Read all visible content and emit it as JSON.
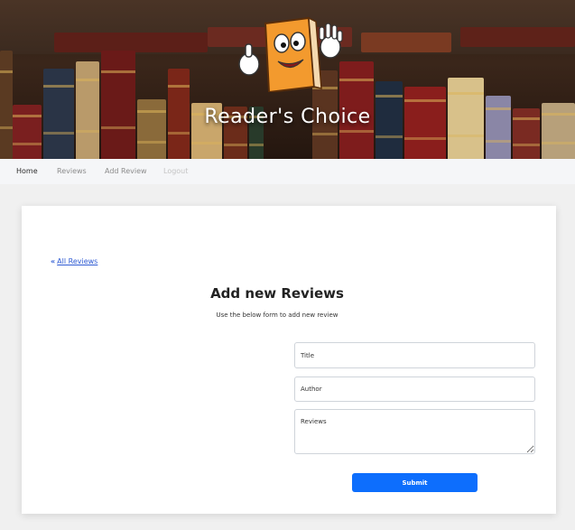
{
  "hero": {
    "title": "Reader's Choice",
    "mascot_icon": "book-mascot-icon"
  },
  "nav": {
    "items": [
      {
        "label": "Home"
      },
      {
        "label": "Reviews"
      },
      {
        "label": "Add Review"
      },
      {
        "label": "Logout"
      }
    ]
  },
  "card": {
    "back_link": "All Reviews",
    "back_icon": "double-chevron-left-icon",
    "title": "Add new Reviews",
    "subtitle": "Use the below form to add new review",
    "form": {
      "title_placeholder": "Title",
      "author_placeholder": "Author",
      "reviews_placeholder": "Reviews",
      "submit_label": "Submit"
    }
  },
  "colors": {
    "accent": "#0d6efd",
    "link": "#2f5bd3",
    "nav_bg": "#f5f6f8",
    "page_bg": "#f0f0f0"
  }
}
